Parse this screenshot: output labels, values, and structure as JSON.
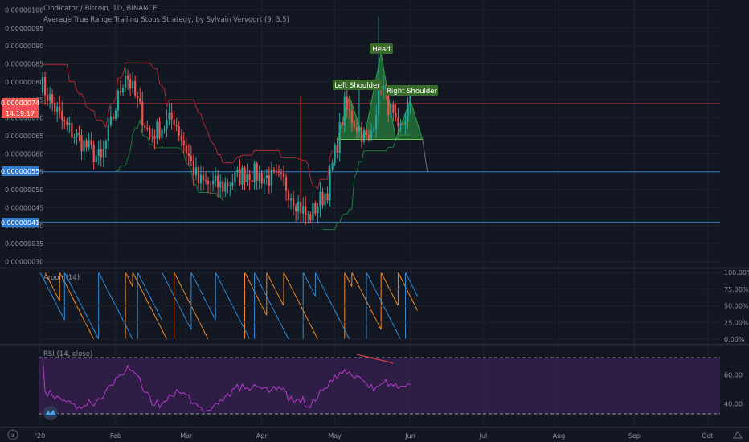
{
  "header": {
    "symbol_line": "Cindicator / Bitcoin, 1D, BINANCE",
    "strategy_line": "Average True Range Trailing Stops Strategy, by Sylvain Vervoort (9, 3.5)"
  },
  "colors": {
    "background": "#131722",
    "up": "#26a69a",
    "down": "#ef5350",
    "stop_red": "#b22833",
    "stop_green": "#1b7a3b",
    "hline_red": "#9e2a36",
    "hline_blue": "#2d7bd1",
    "pattern": "#2ea043",
    "aroon_up": "#f5891f",
    "aroon_down": "#2b8ede",
    "rsi": "#b73bcf",
    "rsi_band": "#3a2152"
  },
  "price_tags": {
    "last_price": "0.00000074",
    "countdown": "14:19:17",
    "line_upper": "0.00000055",
    "line_lower": "0.00000041"
  },
  "annotations": {
    "head": "Head",
    "left_shoulder": "Left Shoulder",
    "right_shoulder": "Right Shoulder"
  },
  "panes": {
    "aroon_label": "Aroon (14)",
    "rsi_label": "RSI (14, close)"
  },
  "chart_data": [
    {
      "type": "candlestick",
      "title": "Cindicator / Bitcoin, 1D, BINANCE",
      "y_ticks": [
        "0.00000100",
        "0.00000095",
        "0.00000090",
        "0.00000085",
        "0.00000080",
        "0.00000075",
        "0.00000070",
        "0.00000065",
        "0.00000060",
        "0.00000055",
        "0.00000050",
        "0.00000045",
        "0.00000040",
        "0.00000035",
        "0.00000030"
      ],
      "ylim": [
        2.9e-07,
        1.01e-06
      ],
      "x_ticks": [
        "'20",
        "Feb",
        "Mar",
        "Apr",
        "May",
        "Jun",
        "Jul",
        "Aug",
        "Sep",
        "Oct"
      ],
      "price_path": [
        {
          "day": 0,
          "close": 8e-07
        },
        {
          "day": 10,
          "close": 6.8e-07
        },
        {
          "day": 25,
          "close": 5.8e-07
        },
        {
          "day": 35,
          "close": 8.3e-07
        },
        {
          "day": 45,
          "close": 6.5e-07
        },
        {
          "day": 55,
          "close": 7e-07
        },
        {
          "day": 65,
          "close": 5.2e-07
        },
        {
          "day": 75,
          "close": 5.1e-07
        },
        {
          "day": 85,
          "close": 5.5e-07
        },
        {
          "day": 100,
          "close": 5.2e-07
        },
        {
          "day": 110,
          "close": 4.2e-07
        },
        {
          "day": 118,
          "close": 5e-07
        },
        {
          "day": 125,
          "close": 7.3e-07
        },
        {
          "day": 135,
          "close": 6.3e-07
        },
        {
          "day": 140,
          "close": 8e-07
        },
        {
          "day": 147,
          "close": 6.5e-07
        },
        {
          "day": 152,
          "close": 7.4e-07
        }
      ],
      "head_and_shoulders": {
        "left_shoulder": 7.6e-07,
        "head": 8.8e-07,
        "right_shoulder": 7.5e-07,
        "neckline": 6.4e-07
      },
      "horizontal_lines": [
        7.4e-07,
        5.5e-07,
        4.1e-07
      ]
    },
    {
      "type": "line",
      "title": "Aroon (14)",
      "y_ticks": [
        "100.00%",
        "75.00%",
        "50.00%",
        "25.00%",
        "0.00%"
      ],
      "ylim": [
        0,
        100
      ],
      "series": [
        {
          "name": "Aroon Up",
          "color": "#f5891f"
        },
        {
          "name": "Aroon Down",
          "color": "#2b8ede"
        }
      ]
    },
    {
      "type": "line",
      "title": "RSI (14, close)",
      "y_ticks": [
        "60.00",
        "40.00"
      ],
      "bands": [
        30,
        70
      ],
      "ylim": [
        25,
        80
      ],
      "series": [
        {
          "name": "RSI",
          "color": "#b73bcf"
        }
      ]
    }
  ]
}
